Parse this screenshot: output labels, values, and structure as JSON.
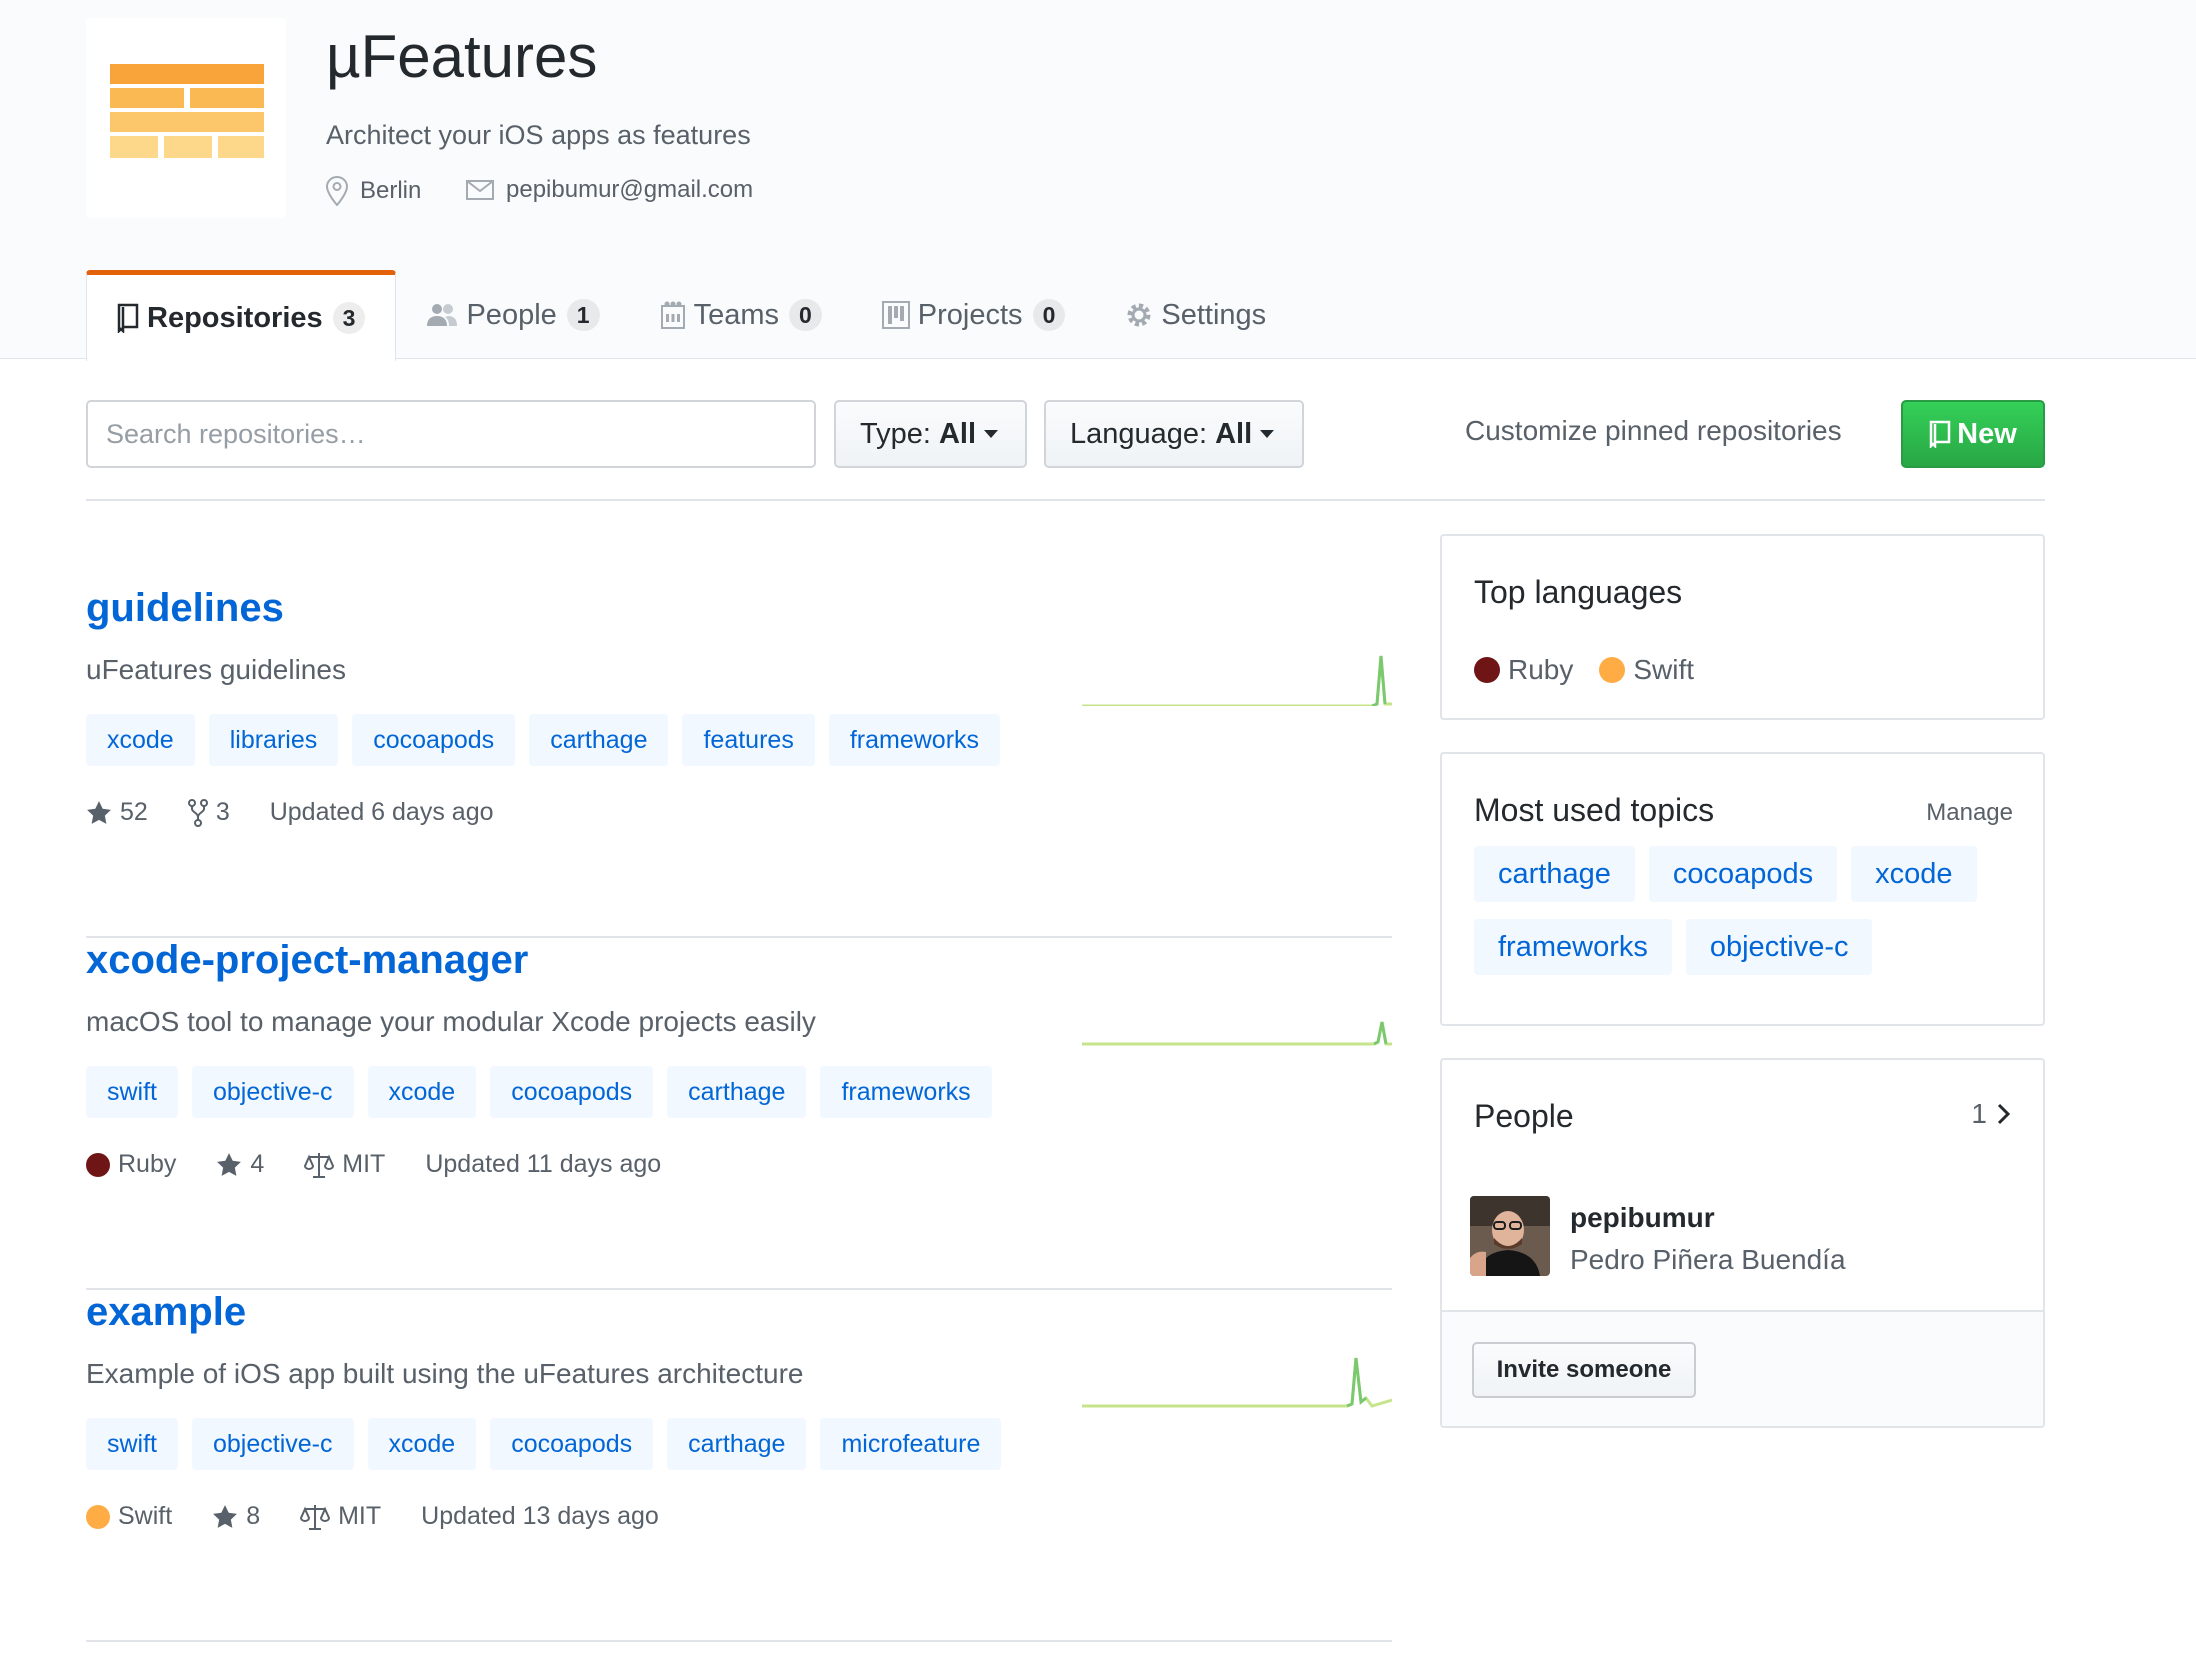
{
  "org": {
    "name": "µFeatures",
    "description": "Architect your iOS apps as features",
    "location": "Berlin",
    "email": "pepibumur@gmail.com"
  },
  "tabs": [
    {
      "label": "Repositories",
      "count": "3",
      "icon": "repo-icon",
      "selected": true
    },
    {
      "label": "People",
      "count": "1",
      "icon": "people-icon"
    },
    {
      "label": "Teams",
      "count": "0",
      "icon": "teams-icon"
    },
    {
      "label": "Projects",
      "count": "0",
      "icon": "project-icon"
    },
    {
      "label": "Settings",
      "icon": "gear-icon"
    }
  ],
  "filters": {
    "search_placeholder": "Search repositories…",
    "type_label": "Type:",
    "type_value": "All",
    "language_label": "Language:",
    "language_value": "All",
    "customize": "Customize pinned repositories",
    "new_label": "New"
  },
  "colors": {
    "ruby": "#701516",
    "swift": "#ffac45",
    "link": "#0366d6",
    "new_button": "#28a745",
    "tab_accent": "#e36209"
  },
  "repos": [
    {
      "name": "guidelines",
      "description": "uFeatures guidelines",
      "topics": [
        "xcode",
        "libraries",
        "cocoapods",
        "carthage",
        "features",
        "frameworks"
      ],
      "stars": "52",
      "forks": "3",
      "updated": "Updated 6 days ago"
    },
    {
      "name": "xcode-project-manager",
      "description": "macOS tool to manage your modular Xcode projects easily",
      "topics": [
        "swift",
        "objective-c",
        "xcode",
        "cocoapods",
        "carthage",
        "frameworks"
      ],
      "language": "Ruby",
      "stars": "4",
      "license": "MIT",
      "updated": "Updated 11 days ago"
    },
    {
      "name": "example",
      "description": "Example of iOS app built using the uFeatures architecture",
      "topics": [
        "swift",
        "objective-c",
        "xcode",
        "cocoapods",
        "carthage",
        "microfeature"
      ],
      "language": "Swift",
      "stars": "8",
      "license": "MIT",
      "updated": "Updated 13 days ago"
    }
  ],
  "sidebar": {
    "top_languages": {
      "title": "Top languages",
      "items": [
        "Ruby",
        "Swift"
      ]
    },
    "topics": {
      "title": "Most used topics",
      "manage": "Manage",
      "items": [
        "carthage",
        "cocoapods",
        "xcode",
        "frameworks",
        "objective-c"
      ]
    },
    "people": {
      "title": "People",
      "count": "1",
      "login": "pepibumur",
      "fullname": "Pedro Piñera Buendía",
      "invite": "Invite someone"
    }
  }
}
